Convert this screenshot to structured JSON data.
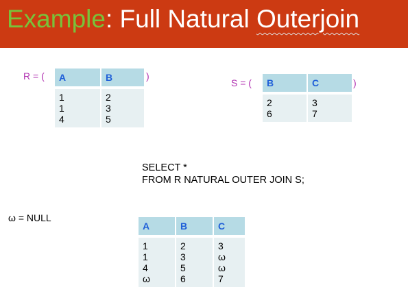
{
  "title": {
    "accent": "Example",
    "rest_prefix": ": Full Natural ",
    "rest_squiggle": "Outerjoin"
  },
  "r_relation": {
    "label": "R = (",
    "close": ")",
    "columns": [
      "A",
      "B"
    ],
    "rows": [
      [
        "1",
        "2"
      ],
      [
        "1",
        "3"
      ],
      [
        "4",
        "5"
      ]
    ]
  },
  "s_relation": {
    "label": "S = (",
    "close": ")",
    "columns": [
      "B",
      "C"
    ],
    "rows": [
      [
        "2",
        "3"
      ],
      [
        "6",
        "7"
      ]
    ]
  },
  "sql": {
    "line1": "SELECT *",
    "line2": "FROM R NATURAL OUTER JOIN S;"
  },
  "null_note": "ω = NULL",
  "result": {
    "columns": [
      "A",
      "B",
      "C"
    ],
    "rows": [
      [
        "1",
        "2",
        "3"
      ],
      [
        "1",
        "3",
        "ω"
      ],
      [
        "4",
        "5",
        "ω"
      ],
      [
        "ω",
        "6",
        "7"
      ]
    ]
  },
  "colors": {
    "title_bg": "#cc3a12",
    "title_accent": "#79c23a",
    "header_bg": "#b6dbe5",
    "header_text": "#1f5fd8",
    "body_bg": "#e7f0f2",
    "label_color": "#b030b0"
  }
}
